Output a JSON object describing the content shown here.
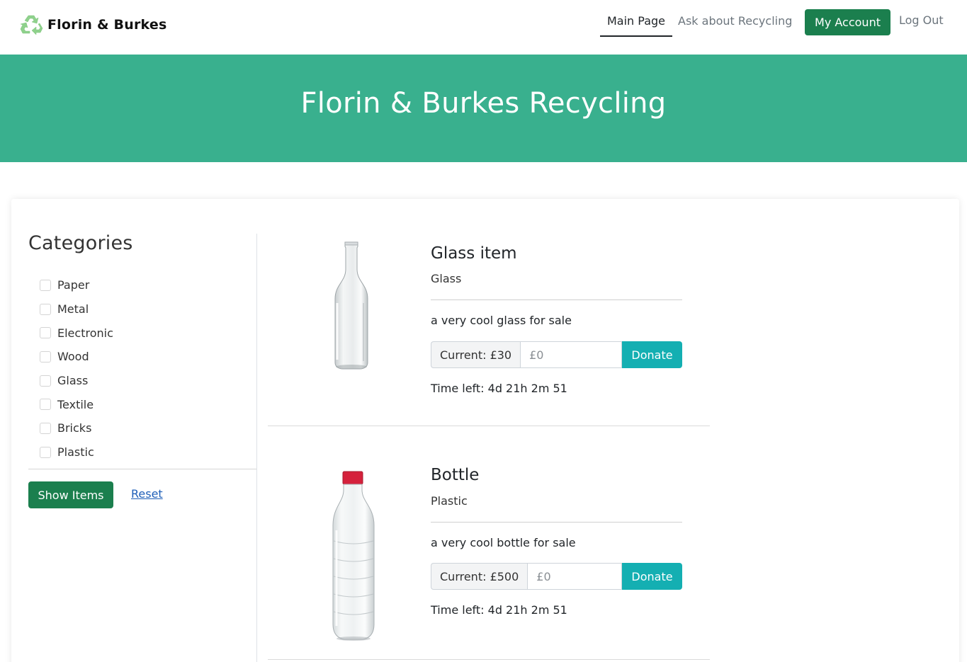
{
  "navbar": {
    "brand": "Florin & Burkes",
    "logo_icon": "recycle-icon",
    "links": {
      "main_page": "Main Page",
      "ask_recycling": "Ask about Recycling",
      "my_account": "My Account",
      "log_out": "Log Out"
    },
    "active_link": "Main Page",
    "colors": {
      "account_button": "#1b7f4e"
    }
  },
  "hero": {
    "title": "Florin & Burkes Recycling",
    "background": "#39b08e"
  },
  "sidebar": {
    "title": "Categories",
    "categories": [
      "Paper",
      "Metal",
      "Electronic",
      "Wood",
      "Glass",
      "Textile",
      "Bricks",
      "Plastic"
    ],
    "show_button": "Show Items",
    "reset_link": "Reset"
  },
  "items": [
    {
      "title": "Glass item",
      "category": "Glass",
      "description": "a very cool glass for sale",
      "current_bid": "Current: £30",
      "input_placeholder": "£0",
      "donate_label": "Donate",
      "time_left": "Time left: 4d 21h 2m 51",
      "image": "glass-bottle-image"
    },
    {
      "title": "Bottle",
      "category": "Plastic",
      "description": "a very cool bottle for sale",
      "current_bid": "Current: £500",
      "input_placeholder": "£0",
      "donate_label": "Donate",
      "time_left": "Time left: 4d 21h 2m 51",
      "image": "plastic-bottle-image"
    }
  ],
  "colors": {
    "primary_green": "#1b7f4e",
    "donate_teal": "#14afb2",
    "link_blue": "#1f5fb8"
  }
}
